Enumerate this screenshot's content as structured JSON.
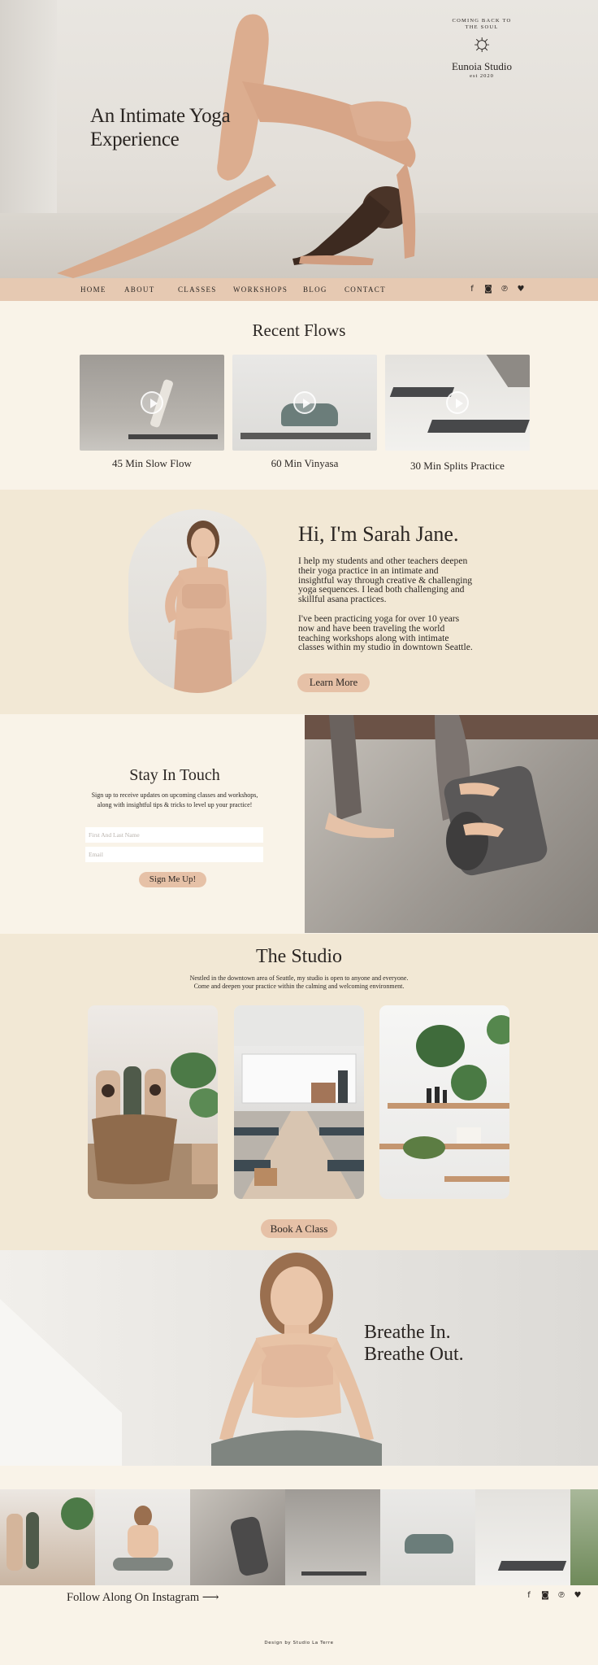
{
  "hero": {
    "title_line1": "An Intimate Yoga",
    "title_line2": "Experience",
    "badge": {
      "ring": "COMING BACK TO THE SOUL",
      "name": "Eunoia Studio",
      "est": "est 2020"
    }
  },
  "nav": {
    "items": [
      "HOME",
      "ABOUT",
      "CLASSES",
      "WORKSHOPS",
      "BLOG",
      "CONTACT"
    ],
    "social": [
      "f",
      "◙",
      "℗",
      "♥"
    ]
  },
  "flows": {
    "heading": "Recent Flows",
    "items": [
      {
        "label": "45 Min Slow Flow"
      },
      {
        "label": "60 Min Vinyasa"
      },
      {
        "label": "30 Min Splits Practice"
      }
    ]
  },
  "about": {
    "heading": "Hi, I'm Sarah Jane.",
    "para1": "I help my students and other teachers deepen their yoga practice in an intimate and insightful way through creative & challenging yoga sequences. I lead both challenging and skillful asana practices.",
    "para2": "I've been practicing yoga for over 10 years now and have been traveling the world teaching workshops along with intimate classes within my studio in downtown Seattle.",
    "button": "Learn More"
  },
  "touch": {
    "heading": "Stay In Touch",
    "sub": "Sign up to receive updates on upcoming classes and workshops, along with insightful tips & tricks to level up your practice!",
    "name_placeholder": "First And Last Name",
    "email_placeholder": "Email",
    "button": "Sign Me Up!"
  },
  "studio": {
    "heading": "The Studio",
    "desc_line1": "Nestled in the downtown area of Seattle, my studio is open to anyone and everyone.",
    "desc_line2": "Come and deepen your practice within the calming and welcoming environment.",
    "button": "Book A Class"
  },
  "breathe": {
    "line1": "Breathe In.",
    "line2": "Breathe Out."
  },
  "insta": {
    "follow": "Follow Along On Instagram ⟶",
    "credit": "Design by Studio La Terre"
  },
  "colors": {
    "cream": "#f9f3e8",
    "sand": "#f2e8d5",
    "blush": "#e6c9b2",
    "button": "#e6c1a7",
    "text": "#2b2623"
  }
}
